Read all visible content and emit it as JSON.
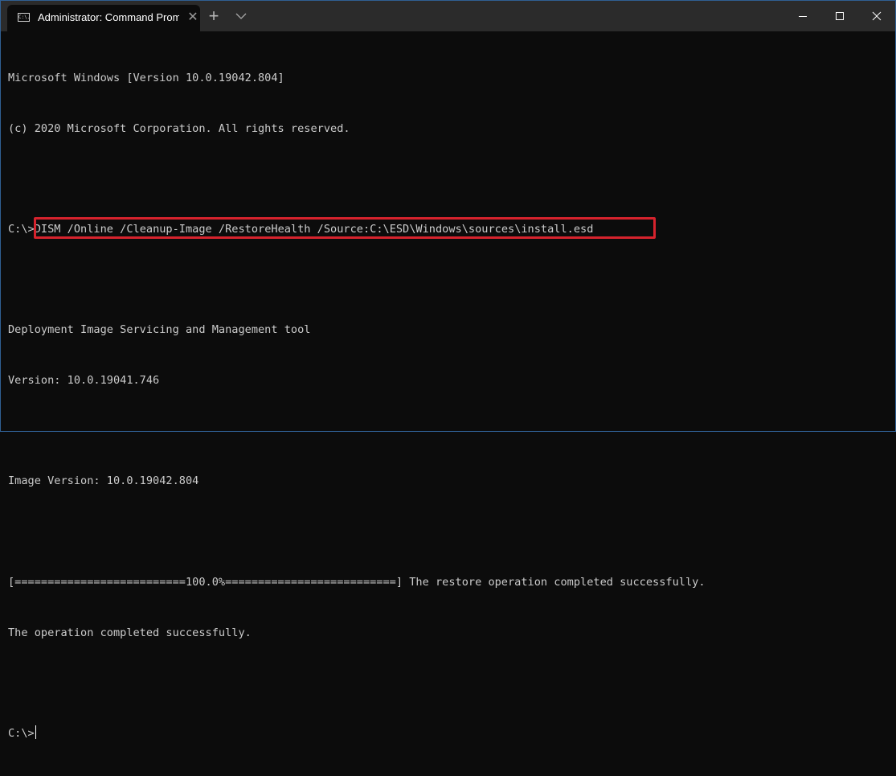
{
  "window": {
    "tab": {
      "icon": "cmd-icon",
      "icon_text": "C:\\.",
      "title": "Administrator: Command Prompt",
      "close_glyph": "✕"
    },
    "new_tab_glyph": "+",
    "controls": {
      "minimize": "minimize",
      "maximize": "maximize",
      "close": "close"
    }
  },
  "terminal": {
    "lines": [
      "Microsoft Windows [Version 10.0.19042.804]",
      "(c) 2020 Microsoft Corporation. All rights reserved.",
      "",
      "",
      "",
      "Deployment Image Servicing and Management tool",
      "Version: 10.0.19041.746",
      "",
      "Image Version: 10.0.19042.804",
      "",
      "[==========================100.0%==========================] The restore operation completed successfully.",
      "The operation completed successfully.",
      "",
      ""
    ],
    "command_prompt": "C:\\>",
    "command": "DISM /Online /Cleanup-Image /RestoreHealth /Source:C:\\ESD\\Windows\\sources\\install.esd",
    "final_prompt": "C:\\>",
    "progress_percent": 100.0,
    "highlight_color": "#d6232d"
  }
}
